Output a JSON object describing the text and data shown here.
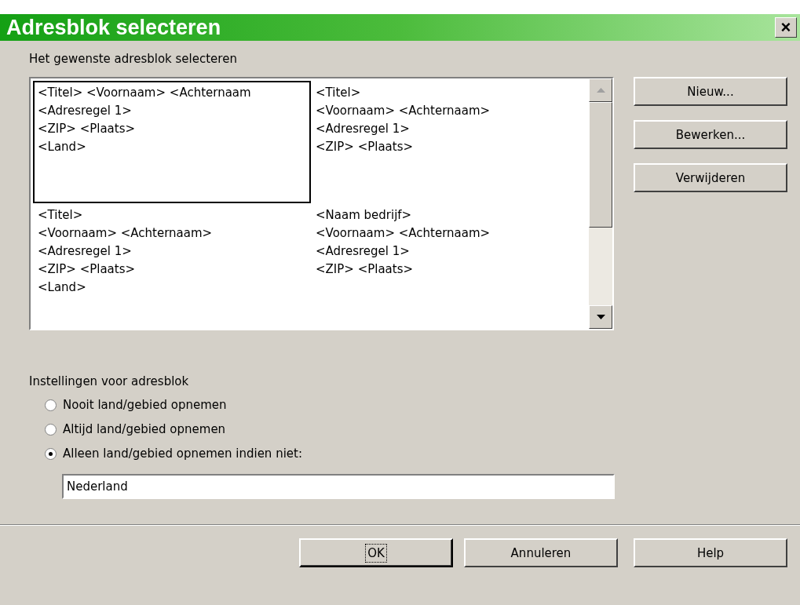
{
  "window": {
    "title": "Adresblok selecteren",
    "close": "×"
  },
  "address_blocks": {
    "label": "Het gewenste adresblok selecteren",
    "items": [
      {
        "lines": [
          "<Titel> <Voornaam> <Achternaam",
          "<Adresregel 1>",
          "<ZIP> <Plaats>",
          "<Land>"
        ],
        "selected": true
      },
      {
        "lines": [
          "<Titel>",
          "<Voornaam> <Achternaam>",
          "<Adresregel 1>",
          "<ZIP> <Plaats>"
        ],
        "selected": false
      },
      {
        "lines": [
          "<Titel>",
          "<Voornaam> <Achternaam>",
          "<Adresregel 1>",
          "<ZIP> <Plaats>",
          "<Land>"
        ],
        "selected": false
      },
      {
        "lines": [
          "<Naam bedrijf>",
          "<Voornaam> <Achternaam>",
          "<Adresregel 1>",
          "<ZIP> <Plaats>"
        ],
        "selected": false
      }
    ]
  },
  "side_buttons": [
    "Nieuw...",
    "Bewerken...",
    "Verwijderen"
  ],
  "settings": {
    "label": "Instellingen voor adresblok",
    "options": [
      {
        "label": "Nooit land/gebied opnemen",
        "selected": false
      },
      {
        "label": "Altijd land/gebied opnemen",
        "selected": false
      },
      {
        "label": "Alleen land/gebied opnemen indien niet:",
        "selected": true
      }
    ],
    "country_field": {
      "value": "Nederland"
    }
  },
  "buttons": [
    {
      "label": "OK",
      "focused": true
    },
    {
      "label": "Annuleren",
      "focused": false
    },
    {
      "label": "Help",
      "focused": false
    }
  ]
}
